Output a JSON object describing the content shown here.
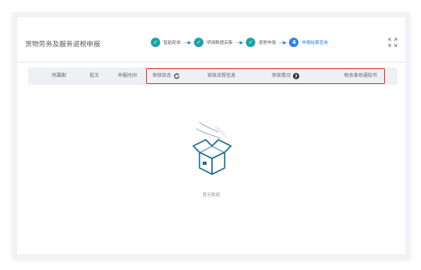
{
  "header": {
    "title": "货物劳务及服务退税申报",
    "steps": [
      {
        "index": "1",
        "label": "智能配单",
        "status": "done"
      },
      {
        "index": "2",
        "label": "明细数据采集",
        "status": "done"
      },
      {
        "index": "3",
        "label": "退税申报",
        "status": "done"
      },
      {
        "index": "4",
        "label": "申报结果查询",
        "status": "current"
      }
    ],
    "step_arrow": "---▶",
    "expand_icon": "expand-icon"
  },
  "table": {
    "columns": [
      "所属期",
      "批次",
      "申报时间",
      "审核状态",
      "审核流程信息",
      "审核情况",
      "税务事项通知书"
    ],
    "highlight_color": "#e03131",
    "rows": []
  },
  "empty_state": {
    "text": "暂无数据",
    "icon": "empty-box-icon"
  },
  "colors": {
    "step_done": "#1aa3a8",
    "step_current": "#2f80ed",
    "header_bg": "#eef0f4"
  }
}
